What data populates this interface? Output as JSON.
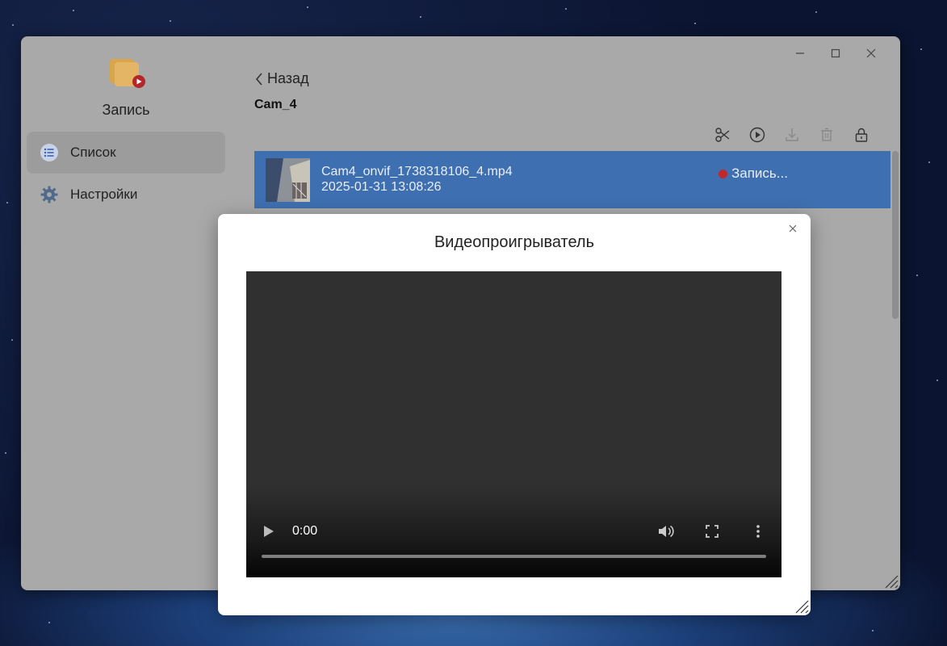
{
  "window": {
    "controls": [
      "minimize-icon",
      "maximize-icon",
      "close-icon"
    ]
  },
  "sidebar": {
    "app_title": "Запись",
    "items": [
      {
        "label": "Список",
        "icon": "list-icon",
        "active": true
      },
      {
        "label": "Настройки",
        "icon": "gear-icon",
        "active": false
      }
    ]
  },
  "content": {
    "back_label": "Назад",
    "camera_title": "Cam_4",
    "toolbar": [
      "scissors-icon",
      "play-circle-icon",
      "download-icon",
      "trash-icon",
      "unlock-icon"
    ],
    "recordings": [
      {
        "filename": "Cam4_onvif_1738318106_4.mp4",
        "datetime": "2025-01-31 13:08:26",
        "status": "Запись...",
        "status_color": "#c0282d",
        "selected": true
      }
    ]
  },
  "modal": {
    "title": "Видеопроигрыватель",
    "player": {
      "time": "0:00",
      "progress": 0
    }
  },
  "colors": {
    "selected_row": "#3e6fb0",
    "window_bg": "#a9a9a9",
    "recording_dot": "#c0282d"
  }
}
